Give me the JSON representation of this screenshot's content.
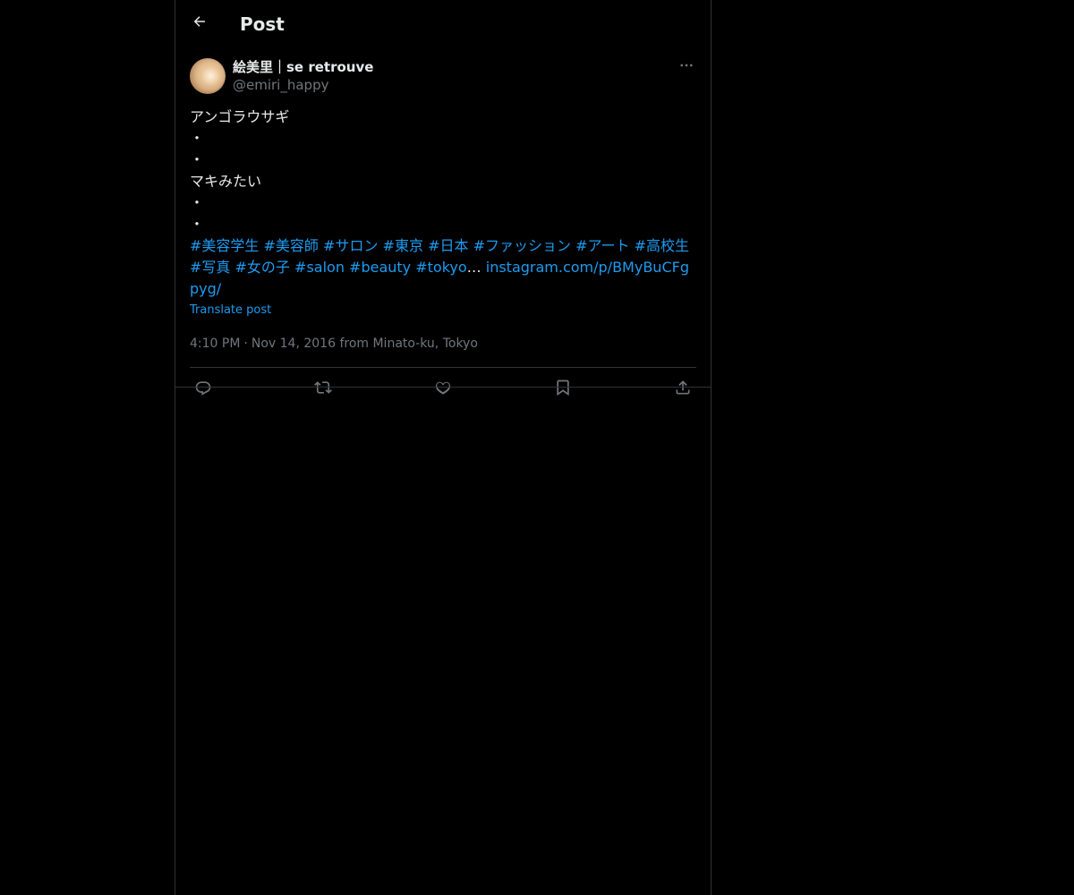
{
  "header": {
    "title": "Post",
    "back_icon": "arrow-left-icon"
  },
  "post": {
    "author": {
      "display_name": "絵美里｜se retrouve",
      "handle": "@emiri_happy"
    },
    "more_icon": "more-horizontal-icon",
    "text_lines": [
      "アンゴラウサギ",
      "・",
      "・",
      "マキみたい",
      "・",
      "・"
    ],
    "hashtags": [
      "#美容学生",
      "#美容師",
      "#サロン",
      "#東京",
      "#日本",
      "#ファッション",
      "#アート",
      "#高校生",
      "#写真",
      "#女の子",
      "#salon",
      "#beauty",
      "#tokyo"
    ],
    "ellipsis": "…",
    "link": "instagram.com/p/BMyBuCFgpyg/",
    "translate_label": "Translate post",
    "time": "4:10 PM",
    "separator": "·",
    "date_location": "Nov 14, 2016 from Minato-ku, Tokyo"
  },
  "actions": {
    "reply_icon": "reply-icon",
    "repost_icon": "repost-icon",
    "like_icon": "heart-icon",
    "bookmark_icon": "bookmark-icon",
    "share_icon": "share-icon"
  },
  "colors": {
    "background": "#000000",
    "text": "#e7e9ea",
    "secondary": "#71767b",
    "accent": "#1d9bf0",
    "border": "#2f3336"
  }
}
